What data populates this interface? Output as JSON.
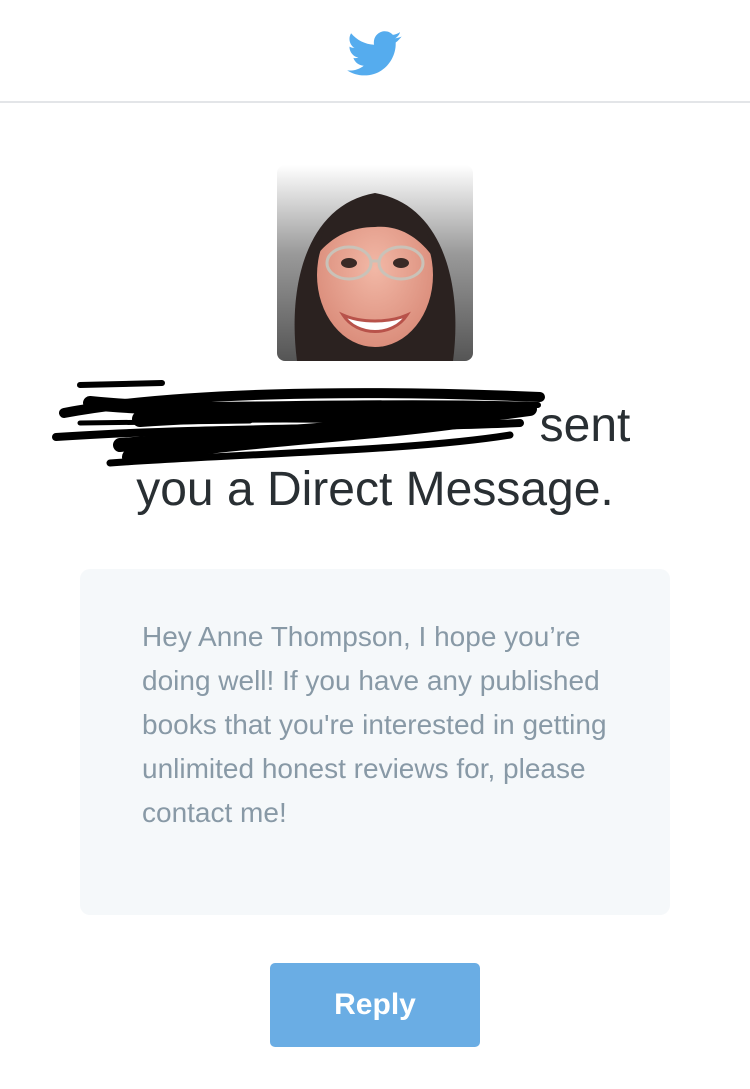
{
  "header": {
    "logo_icon": "twitter-bird-icon",
    "brand_color": "#55acee"
  },
  "notification": {
    "avatar_alt": "sender profile photo",
    "sender_name_redacted": true,
    "line1_suffix": "sent",
    "line2": "you a Direct Message."
  },
  "message": {
    "text": "Hey Anne Thompson, I hope you’re doing well! If you have any published books that you're interested in getting unlimited honest reviews for, please contact me!"
  },
  "actions": {
    "reply_label": "Reply",
    "reply_color": "#6aade4"
  }
}
